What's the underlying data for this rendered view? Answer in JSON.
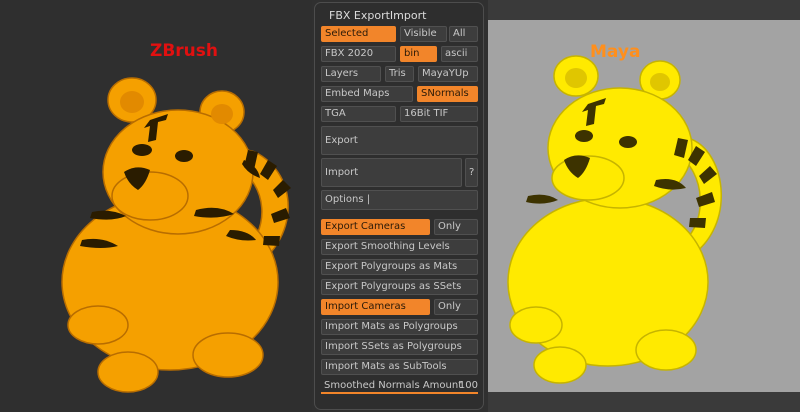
{
  "viewport_left": {
    "label": "ZBrush",
    "label_color": "#e11010",
    "model_color": "#f5a000"
  },
  "viewport_right": {
    "label": "Maya",
    "label_color": "#ff8f1c",
    "model_color": "#ffea00"
  },
  "panel": {
    "title": "FBX ExportImport",
    "row1": {
      "selected": "Selected",
      "visible": "Visible",
      "all": "All"
    },
    "row2": {
      "version": "FBX 2020",
      "bin": "bin",
      "ascii": "ascii"
    },
    "row3": {
      "layers": "Layers",
      "tris": "Tris",
      "mayayup": "MayaYUp"
    },
    "row4": {
      "embed_maps": "Embed Maps",
      "snormals": "SNormals"
    },
    "row5": {
      "tga": "TGA",
      "tif": "16Bit TIF"
    },
    "export": "Export",
    "import": "Import",
    "help": "?",
    "options": "Options  |",
    "export_cameras": "Export Cameras",
    "export_cameras_only": "Only",
    "export_smoothing": "Export Smoothing Levels",
    "export_polygroups": "Export Polygroups as Mats",
    "export_polygroups_ssets": "Export Polygroups as SSets",
    "import_cameras": "Import Cameras",
    "import_cameras_only": "Only",
    "import_mats_polygroups": "Import Mats as Polygroups",
    "import_ssets_polygroups": "Import SSets as Polygroups",
    "import_mats_subtools": "Import Mats as SubTools",
    "smoothed_normals_label": "Smoothed Normals Amount",
    "smoothed_normals_value": "100",
    "smoothed_normals_fraction": 1.0,
    "accent_color": "#f2852a"
  }
}
